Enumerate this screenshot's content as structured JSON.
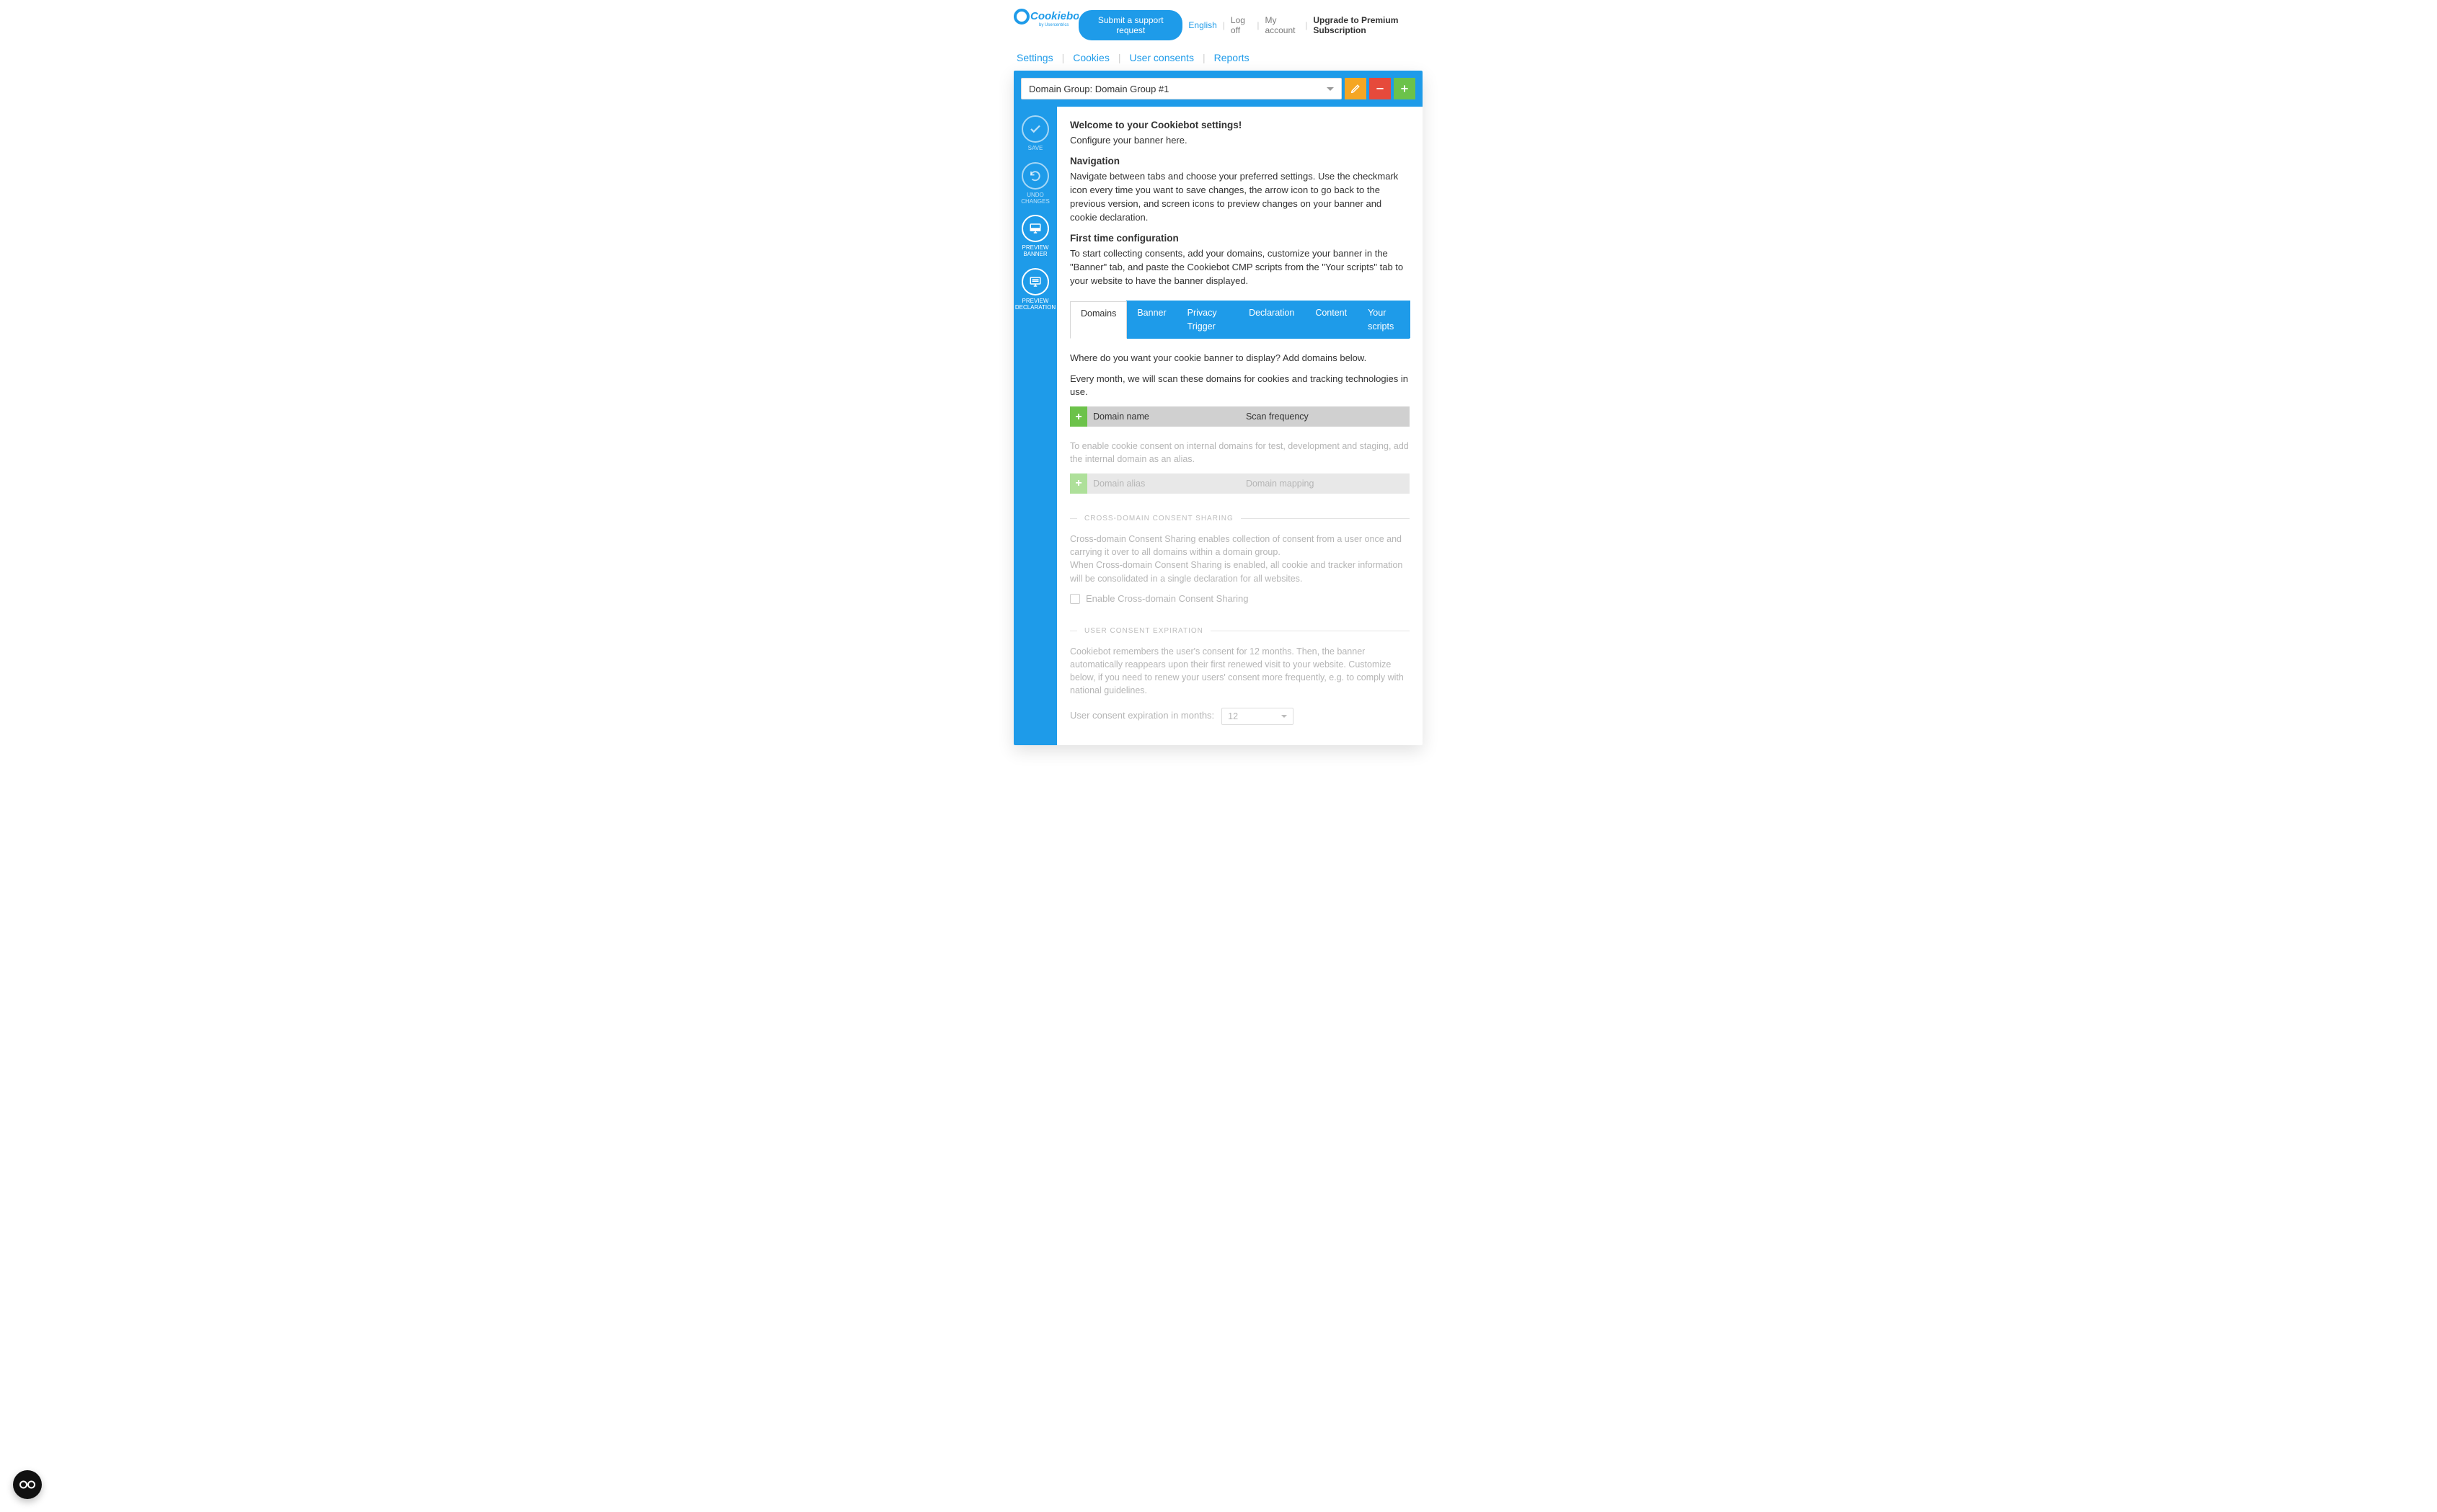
{
  "header": {
    "logo_main": "Cookiebot",
    "logo_sub": "by Usercentrics",
    "support_btn": "Submit a support request",
    "links": {
      "lang": "English",
      "logoff": "Log off",
      "account": "My account",
      "upgrade": "Upgrade to Premium Subscription"
    }
  },
  "top_tabs": [
    "Settings",
    "Cookies",
    "User consents",
    "Reports"
  ],
  "domain_bar": {
    "selected": "Domain Group: Domain Group #1",
    "edit_icon": "pencil-icon",
    "remove_icon": "minus-icon",
    "add_icon": "plus-icon"
  },
  "rail": [
    {
      "label": "SAVE",
      "icon": "check"
    },
    {
      "label": "UNDO CHANGES",
      "icon": "undo"
    },
    {
      "label": "PREVIEW BANNER",
      "icon": "screen",
      "active": true
    },
    {
      "label": "PREVIEW DECLARATION",
      "icon": "screen-lines",
      "active": true
    }
  ],
  "intro": {
    "welcome_title": "Welcome to your Cookiebot settings!",
    "welcome_body": "Configure your banner here.",
    "nav_title": "Navigation",
    "nav_body": "Navigate between tabs and choose your preferred settings. Use the checkmark icon every time you want to save changes, the arrow icon to go back to the previous version, and screen icons to preview changes on your banner and cookie declaration.",
    "first_title": "First time configuration",
    "first_body": "To start collecting consents, add your domains, customize your banner in the \"Banner\" tab, and paste the Cookiebot CMP scripts from the \"Your scripts\" tab to your website to have the banner displayed."
  },
  "inner_tabs": [
    "Domains",
    "Banner",
    "Privacy Trigger",
    "Declaration",
    "Content",
    "Your scripts"
  ],
  "domains_panel": {
    "p1": "Where do you want your cookie banner to display? Add domains below.",
    "p2": "Every month, we will scan these domains for cookies and tracking technologies in use.",
    "tbl1": {
      "col1": "Domain name",
      "col2": "Scan frequency"
    },
    "alias_note": "To enable cookie consent on internal domains for test, development and staging, add the internal domain as an alias.",
    "tbl2": {
      "col1": "Domain alias",
      "col2": "Domain mapping"
    },
    "cross_section": {
      "label": "CROSS-DOMAIN CONSENT SHARING",
      "p1": "Cross-domain Consent Sharing enables collection of consent from a user once and carrying it over to all domains within a domain group.",
      "p2": "When Cross-domain Consent Sharing is enabled, all cookie and tracker information will be consolidated in a single declaration for all websites.",
      "checkbox": "Enable Cross-domain Consent Sharing"
    },
    "expire_section": {
      "label": "USER CONSENT EXPIRATION",
      "p1": "Cookiebot remembers the user's consent for 12 months. Then, the banner automatically reappears upon their first renewed visit to your website. Customize below, if you need to renew your users' consent more frequently, e.g. to comply with national guidelines.",
      "field_label": "User consent expiration in months:",
      "value": "12"
    }
  },
  "widget_icon": "consent-widget-icon"
}
